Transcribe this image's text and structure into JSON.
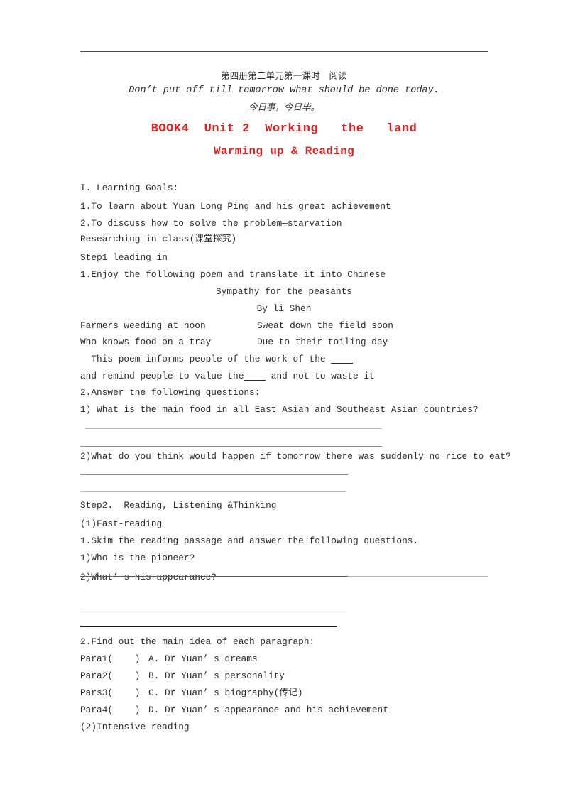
{
  "document": {
    "header_cn": "第四册第二单元第一课时　阅读",
    "quote_en": "Don’t put off till tomorrow what should be done today.",
    "quote_cn_underlined": "今日事，今日毕",
    "quote_cn_tail": "。",
    "title_main": "BOOK4  Unit 2  Working   the   land",
    "title_sub": "Warming up & Reading",
    "accent_color": "#e02020"
  },
  "body": {
    "learning_goals_heading": "I. Learning Goals:",
    "goal_1": "1.To learn about Yuan Long Ping and his great achievement",
    "goal_2": "2.To discuss how to solve the problem—starvation",
    "researching": "Researching in class(课堂探究)",
    "step1_heading": "Step1 leading in",
    "step1_item1": "1.Enjoy the following poem and translate it into Chinese",
    "poem": {
      "title": "Sympathy for the peasants",
      "author": "By li Shen",
      "line1_left": "Farmers weeding at noon",
      "line1_right": "Sweat down the field soon",
      "line2_left": "Who knows food on a tray",
      "line2_right": "Due to their toiling day"
    },
    "poem_fill1_prefix": "  This poem informs people of the work of the ",
    "poem_fill1_blank": "    ",
    "poem_fill2_prefix": "and remind people to value the",
    "poem_fill2_blank": "    ",
    "poem_fill2_suffix": " and not to waste it",
    "step1_item2": "2.Answer the following questions:",
    "q1": "1) What is the main food in all East Asian and Southeast Asian countries?",
    "q2": "2)What do you think would happen if tomorrow there was suddenly no rice to eat?",
    "step2_heading": "Step2.  Reading, Listening &Thinking",
    "fast_reading": "(1)Fast-reading",
    "skim_item": "1.Skim the reading passage and answer the following questions.",
    "q3": "1)Who is the pioneer?",
    "q4": "2)What’ s his appearance?",
    "main_idea_heading": "2.Find out the main idea of each paragraph:",
    "matching": [
      {
        "para": "Para1(    )",
        "option": "A. Dr Yuan’ s dreams"
      },
      {
        "para": "Para2(    )",
        "option": "B. Dr Yuan’ s personality"
      },
      {
        "para": "Pars3(    )",
        "option": "C. Dr Yuan’ s biography(传记)"
      },
      {
        "para": "Para4(    )",
        "option": "D. Dr Yuan’ s appearance and his achievement"
      }
    ],
    "intensive_reading": "(2)Intensive reading"
  }
}
